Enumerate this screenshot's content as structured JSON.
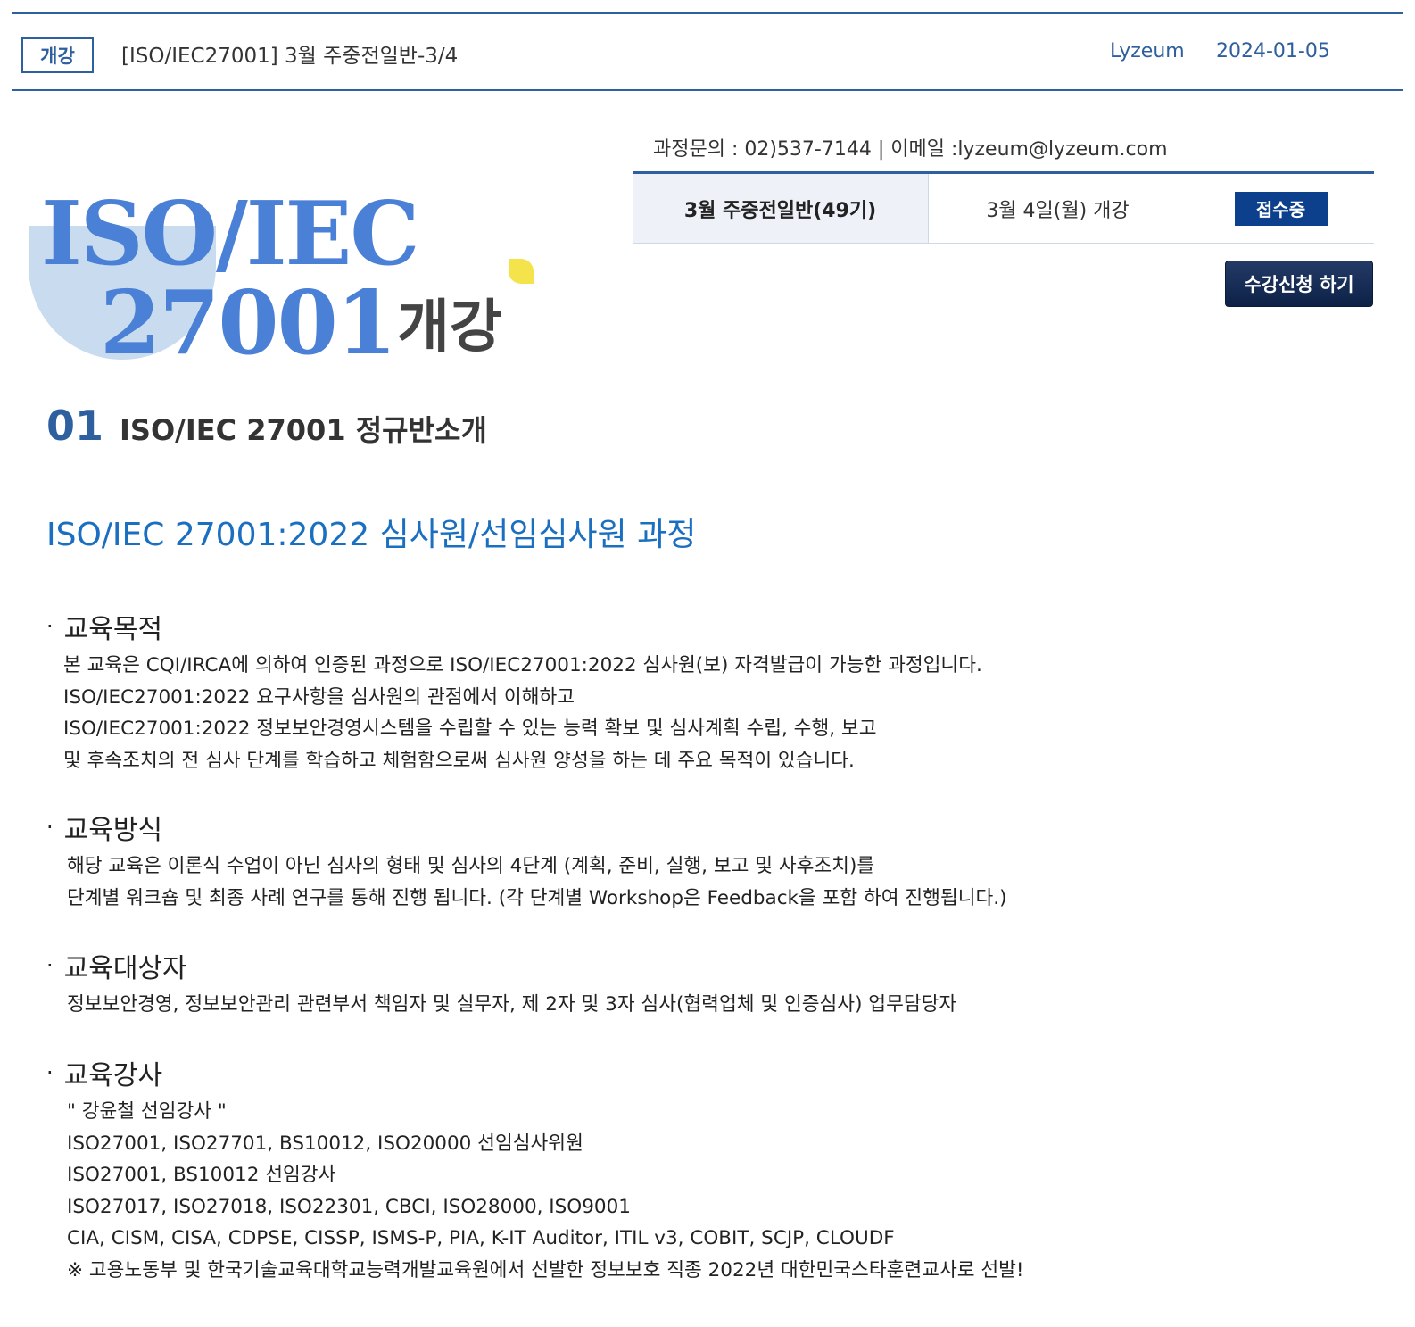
{
  "header": {
    "badge": "개강",
    "title": "[ISO/IEC27001] 3월 주중전일반-3/4",
    "author": "Lyzeum",
    "date": "2024-01-05"
  },
  "banner": {
    "line1": "ISO/IEC",
    "line2": "27001",
    "korean": "개강",
    "section_number": "01",
    "section_label": "ISO/IEC 27001 정규반소개"
  },
  "contact": {
    "text": "과정문의 : 02)537-7144  |  이메일 :lyzeum@lyzeum.com"
  },
  "course_table": {
    "name": "3월 주중전일반(49기)",
    "start": "3월 4일(월) 개강",
    "status": "접수중"
  },
  "apply_button": "수강신청 하기",
  "course_heading": "ISO/IEC 27001:2022 심사원/선임심사원 과정",
  "sections": {
    "purpose": {
      "title": "교육목적",
      "lines": [
        "본 교육은 CQI/IRCA에 의하여 인증된 과정으로 ISO/IEC27001:2022 심사원(보) 자격발급이 가능한 과정입니다.",
        "ISO/IEC27001:2022 요구사항을 심사원의 관점에서 이해하고",
        "ISO/IEC27001:2022 정보보안경영시스템을 수립할 수 있는 능력 확보 및 심사계획 수립, 수행, 보고",
        "및 후속조치의 전 심사 단계를 학습하고 체험함으로써 심사원 양성을 하는 데 주요 목적이 있습니다."
      ]
    },
    "method": {
      "title": "교육방식",
      "lines": [
        "해당 교육은 이론식 수업이 아닌 심사의 형태 및 심사의 4단계 (계획, 준비, 실행, 보고 및 사후조치)를",
        "단계별 워크숍 및 최종 사례 연구를 통해 진행 됩니다. (각 단계별 Workshop은 Feedback을 포함 하여 진행됩니다.)"
      ]
    },
    "target": {
      "title": "교육대상자",
      "lines": [
        "정보보안경영, 정보보안관리 관련부서 책임자 및 실무자, 제 2자 및 3자 심사(협력업체 및 인증심사) 업무담당자"
      ]
    },
    "instructor": {
      "title": "교육강사",
      "lines": [
        "\" 강윤철 선임강사 \"",
        "ISO27001, ISO27701, BS10012, ISO20000 선임심사위원",
        "ISO27001, BS10012 선임강사",
        "ISO27017, ISO27018, ISO22301, CBCI, ISO28000, ISO9001",
        "CIA, CISM, CISA, CDPSE, CISSP, ISMS-P, PIA, K-IT Auditor, ITIL v3, COBIT, SCJP, CLOUDF",
        "※ 고용노동부 및 한국기술교육대학교능력개발교육원에서 선발한 정보보호 직종 2022년 대한민국스타훈련교사로 선발!"
      ]
    }
  },
  "bullet": "·"
}
